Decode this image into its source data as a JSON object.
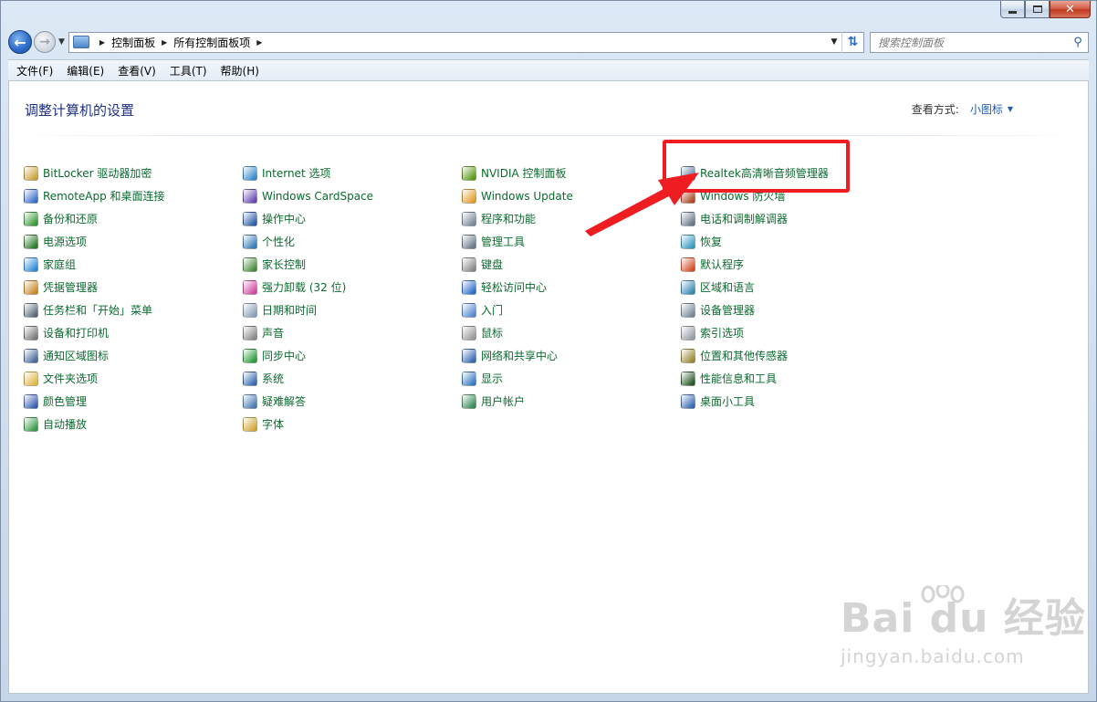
{
  "window": {
    "caption": {
      "minimize": "",
      "maximize": "",
      "close": "✕"
    }
  },
  "nav": {
    "breadcrumbs": [
      "控制面板",
      "所有控制面板项"
    ],
    "search_placeholder": "搜索控制面板"
  },
  "menubar": [
    "文件(F)",
    "编辑(E)",
    "查看(V)",
    "工具(T)",
    "帮助(H)"
  ],
  "content": {
    "title": "调整计算机的设置",
    "view_label": "查看方式:",
    "view_value": "小图标"
  },
  "columns": [
    [
      {
        "label": "BitLocker 驱动器加密",
        "icon": "bitlocker-icon",
        "color": "#c9a33b"
      },
      {
        "label": "RemoteApp 和桌面连接",
        "icon": "remoteapp-icon",
        "color": "#3b6fc9"
      },
      {
        "label": "备份和还原",
        "icon": "backup-icon",
        "color": "#3d9a3d"
      },
      {
        "label": "电源选项",
        "icon": "power-icon",
        "color": "#2c7a2c"
      },
      {
        "label": "家庭组",
        "icon": "homegroup-icon",
        "color": "#2f8ad8"
      },
      {
        "label": "凭据管理器",
        "icon": "credential-icon",
        "color": "#c98a2b"
      },
      {
        "label": "任务栏和「开始」菜单",
        "icon": "taskbar-icon",
        "color": "#5a6a7a"
      },
      {
        "label": "设备和打印机",
        "icon": "printer-icon",
        "color": "#7a7a7a"
      },
      {
        "label": "通知区域图标",
        "icon": "notification-icon",
        "color": "#4a6c9a"
      },
      {
        "label": "文件夹选项",
        "icon": "folder-icon",
        "color": "#e0b84a"
      },
      {
        "label": "颜色管理",
        "icon": "color-icon",
        "color": "#3a5fb0"
      },
      {
        "label": "自动播放",
        "icon": "autoplay-icon",
        "color": "#3a9a4a"
      }
    ],
    [
      {
        "label": "Internet 选项",
        "icon": "internet-icon",
        "color": "#3a8ac9"
      },
      {
        "label": "Windows CardSpace",
        "icon": "cardspace-icon",
        "color": "#6a4ab0"
      },
      {
        "label": "操作中心",
        "icon": "flag-icon",
        "color": "#2f5fa8"
      },
      {
        "label": "个性化",
        "icon": "personalize-icon",
        "color": "#3a7ab8"
      },
      {
        "label": "家长控制",
        "icon": "parental-icon",
        "color": "#4a8a3a"
      },
      {
        "label": "强力卸载 (32 位)",
        "icon": "uninstall-icon",
        "color": "#d04aa0"
      },
      {
        "label": "日期和时间",
        "icon": "clock-icon",
        "color": "#8aa0b8"
      },
      {
        "label": "声音",
        "icon": "speaker-icon",
        "color": "#8a8a8a"
      },
      {
        "label": "同步中心",
        "icon": "sync-icon",
        "color": "#2e9a3e"
      },
      {
        "label": "系统",
        "icon": "system-icon",
        "color": "#3a6ab0"
      },
      {
        "label": "疑难解答",
        "icon": "troubleshoot-icon",
        "color": "#4a7ab0"
      },
      {
        "label": "字体",
        "icon": "fonts-icon",
        "color": "#d0a83a"
      }
    ],
    [
      {
        "label": "NVIDIA 控制面板",
        "icon": "nvidia-icon",
        "color": "#5a9a1a"
      },
      {
        "label": "Windows Update",
        "icon": "windows-update-icon",
        "color": "#e0a030"
      },
      {
        "label": "程序和功能",
        "icon": "programs-icon",
        "color": "#7a8a9a"
      },
      {
        "label": "管理工具",
        "icon": "admin-tools-icon",
        "color": "#6a7a8a"
      },
      {
        "label": "键盘",
        "icon": "keyboard-icon",
        "color": "#8a8a8a"
      },
      {
        "label": "轻松访问中心",
        "icon": "ease-of-access-icon",
        "color": "#2f6fc9"
      },
      {
        "label": "入门",
        "icon": "getting-started-icon",
        "color": "#5a8ad0"
      },
      {
        "label": "鼠标",
        "icon": "mouse-icon",
        "color": "#9a9a9a"
      },
      {
        "label": "网络和共享中心",
        "icon": "network-icon",
        "color": "#3a6ab0"
      },
      {
        "label": "显示",
        "icon": "display-icon",
        "color": "#3a7ac0"
      },
      {
        "label": "用户帐户",
        "icon": "user-accounts-icon",
        "color": "#3a8a5a"
      }
    ],
    [
      {
        "label": "Realtek高清晰音频管理器",
        "icon": "realtek-icon",
        "color": "#5a7aa0"
      },
      {
        "label": "Windows 防火墙",
        "icon": "firewall-icon",
        "color": "#b04a2a"
      },
      {
        "label": "电话和调制解调器",
        "icon": "phone-icon",
        "color": "#6a7a8a"
      },
      {
        "label": "恢复",
        "icon": "recovery-icon",
        "color": "#3a9ac0"
      },
      {
        "label": "默认程序",
        "icon": "default-programs-icon",
        "color": "#d0502a"
      },
      {
        "label": "区域和语言",
        "icon": "region-icon",
        "color": "#3a8ab0"
      },
      {
        "label": "设备管理器",
        "icon": "device-manager-icon",
        "color": "#7a8a9a"
      },
      {
        "label": "索引选项",
        "icon": "indexing-icon",
        "color": "#9aa0a8"
      },
      {
        "label": "位置和其他传感器",
        "icon": "sensors-icon",
        "color": "#9a8a3a"
      },
      {
        "label": "性能信息和工具",
        "icon": "performance-icon",
        "color": "#2a5a2a"
      },
      {
        "label": "桌面小工具",
        "icon": "gadgets-icon",
        "color": "#3a6ab0"
      }
    ]
  ],
  "watermark": {
    "main": "Bai du 经验",
    "sub": "jingyan.baidu.com"
  },
  "annotation": {
    "color": "#ee1d22"
  }
}
